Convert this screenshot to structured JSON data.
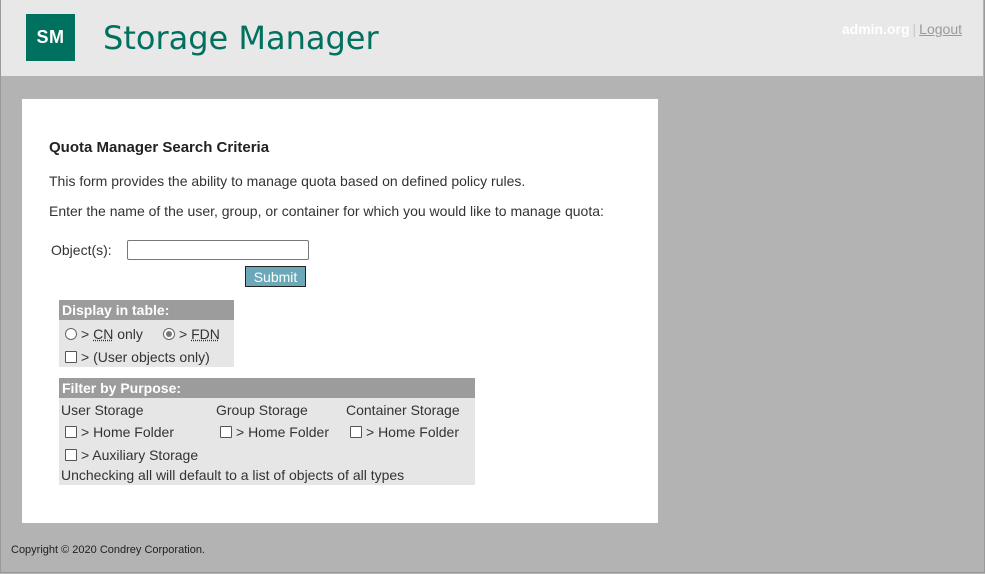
{
  "header": {
    "logo_text": "SM",
    "app_title": "Storage Manager",
    "user": "admin.org",
    "separator": "|",
    "logout": "Logout"
  },
  "form": {
    "title": "Quota Manager Search Criteria",
    "desc1": "This form provides the ability to manage quota based on defined policy rules.",
    "desc2": "Enter the name of the user, group, or container for which you would like to manage quota:",
    "objects_label": "Object(s):",
    "objects_value": "",
    "submit_label": "Submit"
  },
  "display": {
    "heading": "Display in table:",
    "prefix": ">",
    "cn_abbr": "CN",
    "cn_suffix": "only",
    "fdn_abbr": "FDN",
    "selected": "FDN",
    "user_only": "> (User objects only)",
    "user_only_checked": false
  },
  "filter": {
    "heading": "Filter by Purpose:",
    "col_user": "User Storage",
    "col_group": "Group Storage",
    "col_container": "Container Storage",
    "home_folder": "> Home Folder",
    "aux_storage": "> Auxiliary Storage",
    "note": "Unchecking all will default to a list of objects of all types"
  },
  "footer": {
    "copyright": "Copyright © 2020 Condrey Corporation."
  },
  "colors": {
    "brand": "#00705f",
    "submit": "#6ba8b8",
    "box_header": "#9c9c9c"
  }
}
